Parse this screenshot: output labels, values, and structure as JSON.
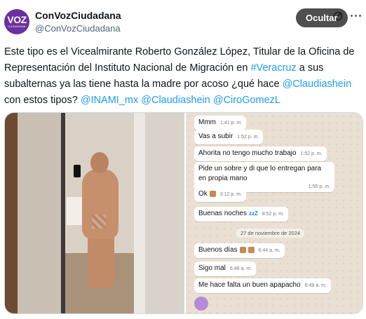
{
  "account": {
    "avatar_text": "VOZ",
    "avatar_subtext": "CIUDADANA",
    "display_name": "ConVozCiudadana",
    "handle": "@ConVozCiudadana"
  },
  "tweet": {
    "text_part1": "Este tipo es el Vicealmirante Roberto González López, Titular de la Oficina de Representación del Instituto Nacional de Migración en ",
    "hashtag_veracruz": "#Veracruz",
    "text_part2": " a sus subalternas ya las tiene hasta la madre por acoso ¿qué hace ",
    "mention_claudia1": "@Claudiashein",
    "text_part3": " con estos tipos? ",
    "mention_inami": "@INAMI_mx",
    "mention_claudia2": "@Claudiashein",
    "mention_ciro": "@CiroGomezL"
  },
  "media": {
    "hide_button_label": "Ocultar",
    "chat": {
      "messages": [
        {
          "text": "Mmm",
          "time": "1:41 p. m."
        },
        {
          "text": "Vas a subir",
          "time": "1:52 p. m."
        },
        {
          "text": "Ahorita no tengo mucho trabajo",
          "time": "1:52 p. m."
        },
        {
          "text": "Pide un sobre y di que lo entregan para en propia mano",
          "time": "1:55 p. m."
        },
        {
          "text": "Ok",
          "time": "3:12 p. m."
        },
        {
          "text": "Buenas noches",
          "time": "8:52 p. m."
        },
        {
          "text": "Buenos días",
          "time": "6:44 a. m."
        },
        {
          "text": "Sigo mal",
          "time": "6:48 a. m."
        },
        {
          "text": "Me hace falta un buen apapacho",
          "time": "6:49 a. m."
        }
      ],
      "date_separator": "27 de noviembre de 2024",
      "zzz": "zzZ"
    }
  },
  "icons": {
    "grok": "grok-icon",
    "more": "more-icon"
  }
}
